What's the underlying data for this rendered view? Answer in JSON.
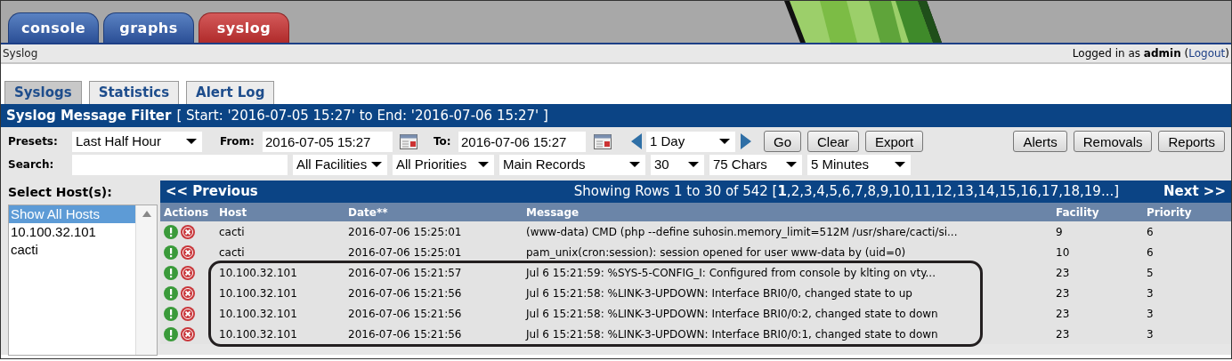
{
  "top_tabs": [
    {
      "label": "console",
      "selected": false
    },
    {
      "label": "graphs",
      "selected": false
    },
    {
      "label": "syslog",
      "selected": true
    }
  ],
  "breadcrumb": "Syslog",
  "login_status": {
    "before": "Logged in as **admin** (",
    "link": "Logout",
    "after": ")"
  },
  "sub_tabs": [
    {
      "label": "Syslogs",
      "selected": true
    },
    {
      "label": "Statistics",
      "selected": false
    },
    {
      "label": "Alert Log",
      "selected": false
    }
  ],
  "filter_header": {
    "title": "Syslog Message Filter",
    "range": "[ Start: '2016-07-05 15:27' to End: '2016-07-06 15:27' ]"
  },
  "filters": {
    "presets_label": "Presets:",
    "preset": "Last Half Hour",
    "from_label": "From:",
    "from": "2016-07-05 15:27",
    "to_label": "To:",
    "to": "2016-07-06 15:27",
    "timespan": "1 Day",
    "buttons": [
      "Go",
      "Clear",
      "Export"
    ],
    "right_buttons": [
      "Alerts",
      "Removals",
      "Reports"
    ],
    "search_label": "Search:",
    "selects": [
      "All Facilities",
      "All Priorities",
      "Main Records",
      "30",
      "75 Chars",
      "5 Minutes"
    ]
  },
  "host_panel": {
    "title": "Select Host(s):",
    "items": [
      {
        "label": "Show All Hosts",
        "selected": true
      },
      {
        "label": "10.100.32.101",
        "selected": false
      },
      {
        "label": "cacti",
        "selected": false
      }
    ]
  },
  "pager": {
    "previous": "<< Previous",
    "summary": "Showing Rows 1 to 30 of 542 [**1**,2,3,4,5,6,7,8,9,10,11,12,13,14,15,16,17,18,19...]",
    "next": "Next >>"
  },
  "table": {
    "columns": [
      "Actions",
      "Host",
      "Date**",
      "Message",
      "Facility",
      "Priority"
    ],
    "rows": [
      {
        "host": "cacti",
        "date": "2016-07-06 15:25:01",
        "message": "(www-data) CMD (php --define suhosin.memory_limit=512M /usr/share/cacti/si...",
        "facility": "9",
        "priority": "6",
        "highlighted": false
      },
      {
        "host": "cacti",
        "date": "2016-07-06 15:25:01",
        "message": "pam_unix(cron:session): session opened for user www-data by (uid=0)",
        "facility": "10",
        "priority": "6",
        "highlighted": false
      },
      {
        "host": "10.100.32.101",
        "date": "2016-07-06 15:21:57",
        "message": "Jul 6 15:21:59: %SYS-5-CONFIG_I: Configured from console by klting on vty...",
        "facility": "23",
        "priority": "5",
        "highlighted": true
      },
      {
        "host": "10.100.32.101",
        "date": "2016-07-06 15:21:56",
        "message": "Jul 6 15:21:58: %LINK-3-UPDOWN: Interface BRI0/0, changed state to up",
        "facility": "23",
        "priority": "3",
        "highlighted": true
      },
      {
        "host": "10.100.32.101",
        "date": "2016-07-06 15:21:56",
        "message": "Jul 6 15:21:58: %LINK-3-UPDOWN: Interface BRI0/0:2, changed state to down",
        "facility": "23",
        "priority": "3",
        "highlighted": true
      },
      {
        "host": "10.100.32.101",
        "date": "2016-07-06 15:21:56",
        "message": "Jul 6 15:21:58: %LINK-3-UPDOWN: Interface BRI0/0:1, changed state to down",
        "facility": "23",
        "priority": "3",
        "highlighted": true
      }
    ]
  }
}
